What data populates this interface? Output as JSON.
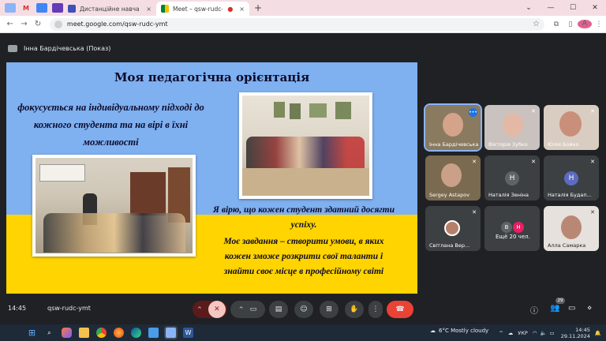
{
  "browser": {
    "tabs": [
      {
        "label": "Дистанційне навчання в ВСП",
        "active": false
      },
      {
        "label": "Meet – qsw-rudc-ymt",
        "active": true
      }
    ],
    "url": "meet.google.com/qsw-rudc-ymt",
    "profile_initial": "A"
  },
  "presenter": {
    "label": "Інна Бардічевська (Показ)"
  },
  "slide": {
    "title": "Моя педагогічна орієнтація",
    "left_text": "фокусується на індивідуальному підході до кожного студента та на вірі в їхні можливості",
    "right_text_1": "Я вірю, що кожен студент здатний досягти успіху.",
    "right_text_2": "Моє завдання – створити умови, в яких кожен зможе розкрити свої таланти і знайти своє місце в професійному світі"
  },
  "participants": [
    {
      "name": "Інна Бардічевська",
      "type": "video",
      "speaking": true
    },
    {
      "name": "Вікторія Зубко",
      "type": "video",
      "muted": true
    },
    {
      "name": "Юлія Бойко",
      "type": "video",
      "muted": true
    },
    {
      "name": "Sergey Astapov",
      "type": "video",
      "muted": true
    },
    {
      "name": "Наталія Зеніна",
      "type": "initial",
      "initial": "Н",
      "color": "#5f6368",
      "muted": true
    },
    {
      "name": "Наталія Будап...",
      "type": "initial",
      "initial": "Н",
      "color": "#5c6bc0",
      "muted": true
    },
    {
      "name": "Світлана Вер...",
      "type": "avatar",
      "muted": true
    },
    {
      "name": "Ещё 20 чел.",
      "type": "more",
      "initials": [
        "В",
        "Н"
      ]
    },
    {
      "name": "Алла Самарка",
      "type": "video",
      "muted": true
    }
  ],
  "meeting": {
    "time": "14:45",
    "code": "qsw-rudc-ymt",
    "participants_count": "29"
  },
  "taskbar": {
    "weather": "6°C  Mostly cloudy",
    "lang": "УКР",
    "time": "14:45",
    "date": "29.11.2024"
  }
}
